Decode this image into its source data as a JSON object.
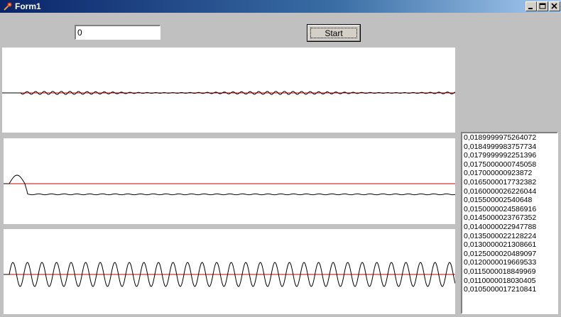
{
  "window": {
    "title": "Form1"
  },
  "controls": {
    "edit_value": "0",
    "start_label": "Start"
  },
  "list": {
    "items": [
      "0,0189999975264072",
      "0,0184999983757734",
      "0,0179999992251396",
      "0,0175000000745058",
      "0,017000000923872",
      "0,0165000017732382",
      "0,0160000026226044",
      "0,015500002540648",
      "0,0150000024586916",
      "0,0145000023767352",
      "0,0140000022947788",
      "0,0135000022128224",
      "0,0130000021308661",
      "0,0125000020489097",
      "0,0120000019669533",
      "0,0115000018849969",
      "0,0110000018030405",
      "0,0105000017210841"
    ]
  },
  "colors": {
    "signal": "#000000",
    "reference": "#cc0000",
    "titlebar": "#0a246a"
  },
  "icons": {
    "app": "torch-icon",
    "minimize": "minimize-icon",
    "maximize": "maximize-icon",
    "close": "close-icon"
  }
}
